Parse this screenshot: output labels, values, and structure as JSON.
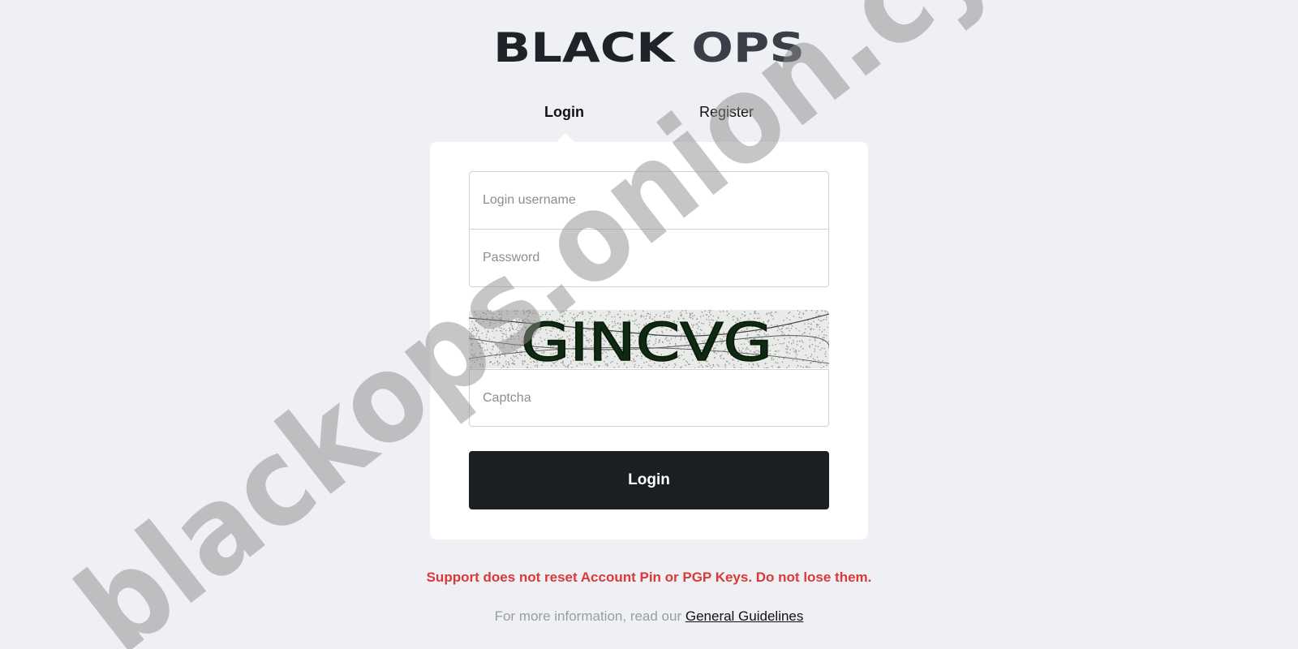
{
  "logo": {
    "text": "BLACK OPS"
  },
  "tabs": [
    {
      "label": "Login",
      "active": true
    },
    {
      "label": "Register",
      "active": false
    }
  ],
  "form": {
    "username_placeholder": "Login username",
    "password_placeholder": "Password",
    "captcha_text": "GINCVG",
    "captcha_placeholder": "Captcha",
    "submit_label": "Login"
  },
  "notice": "Support does not reset Account Pin or PGP Keys. Do not lose them.",
  "info": {
    "prefix": "For more information, read our ",
    "link_label": "General Guidelines"
  },
  "watermark": "blackops.onion.cyou",
  "colors": {
    "background": "#eef0f4",
    "button": "#1b1f23",
    "notice": "#dc3838",
    "logo": "#1f2228",
    "logo_ops": "#3a3f47"
  }
}
